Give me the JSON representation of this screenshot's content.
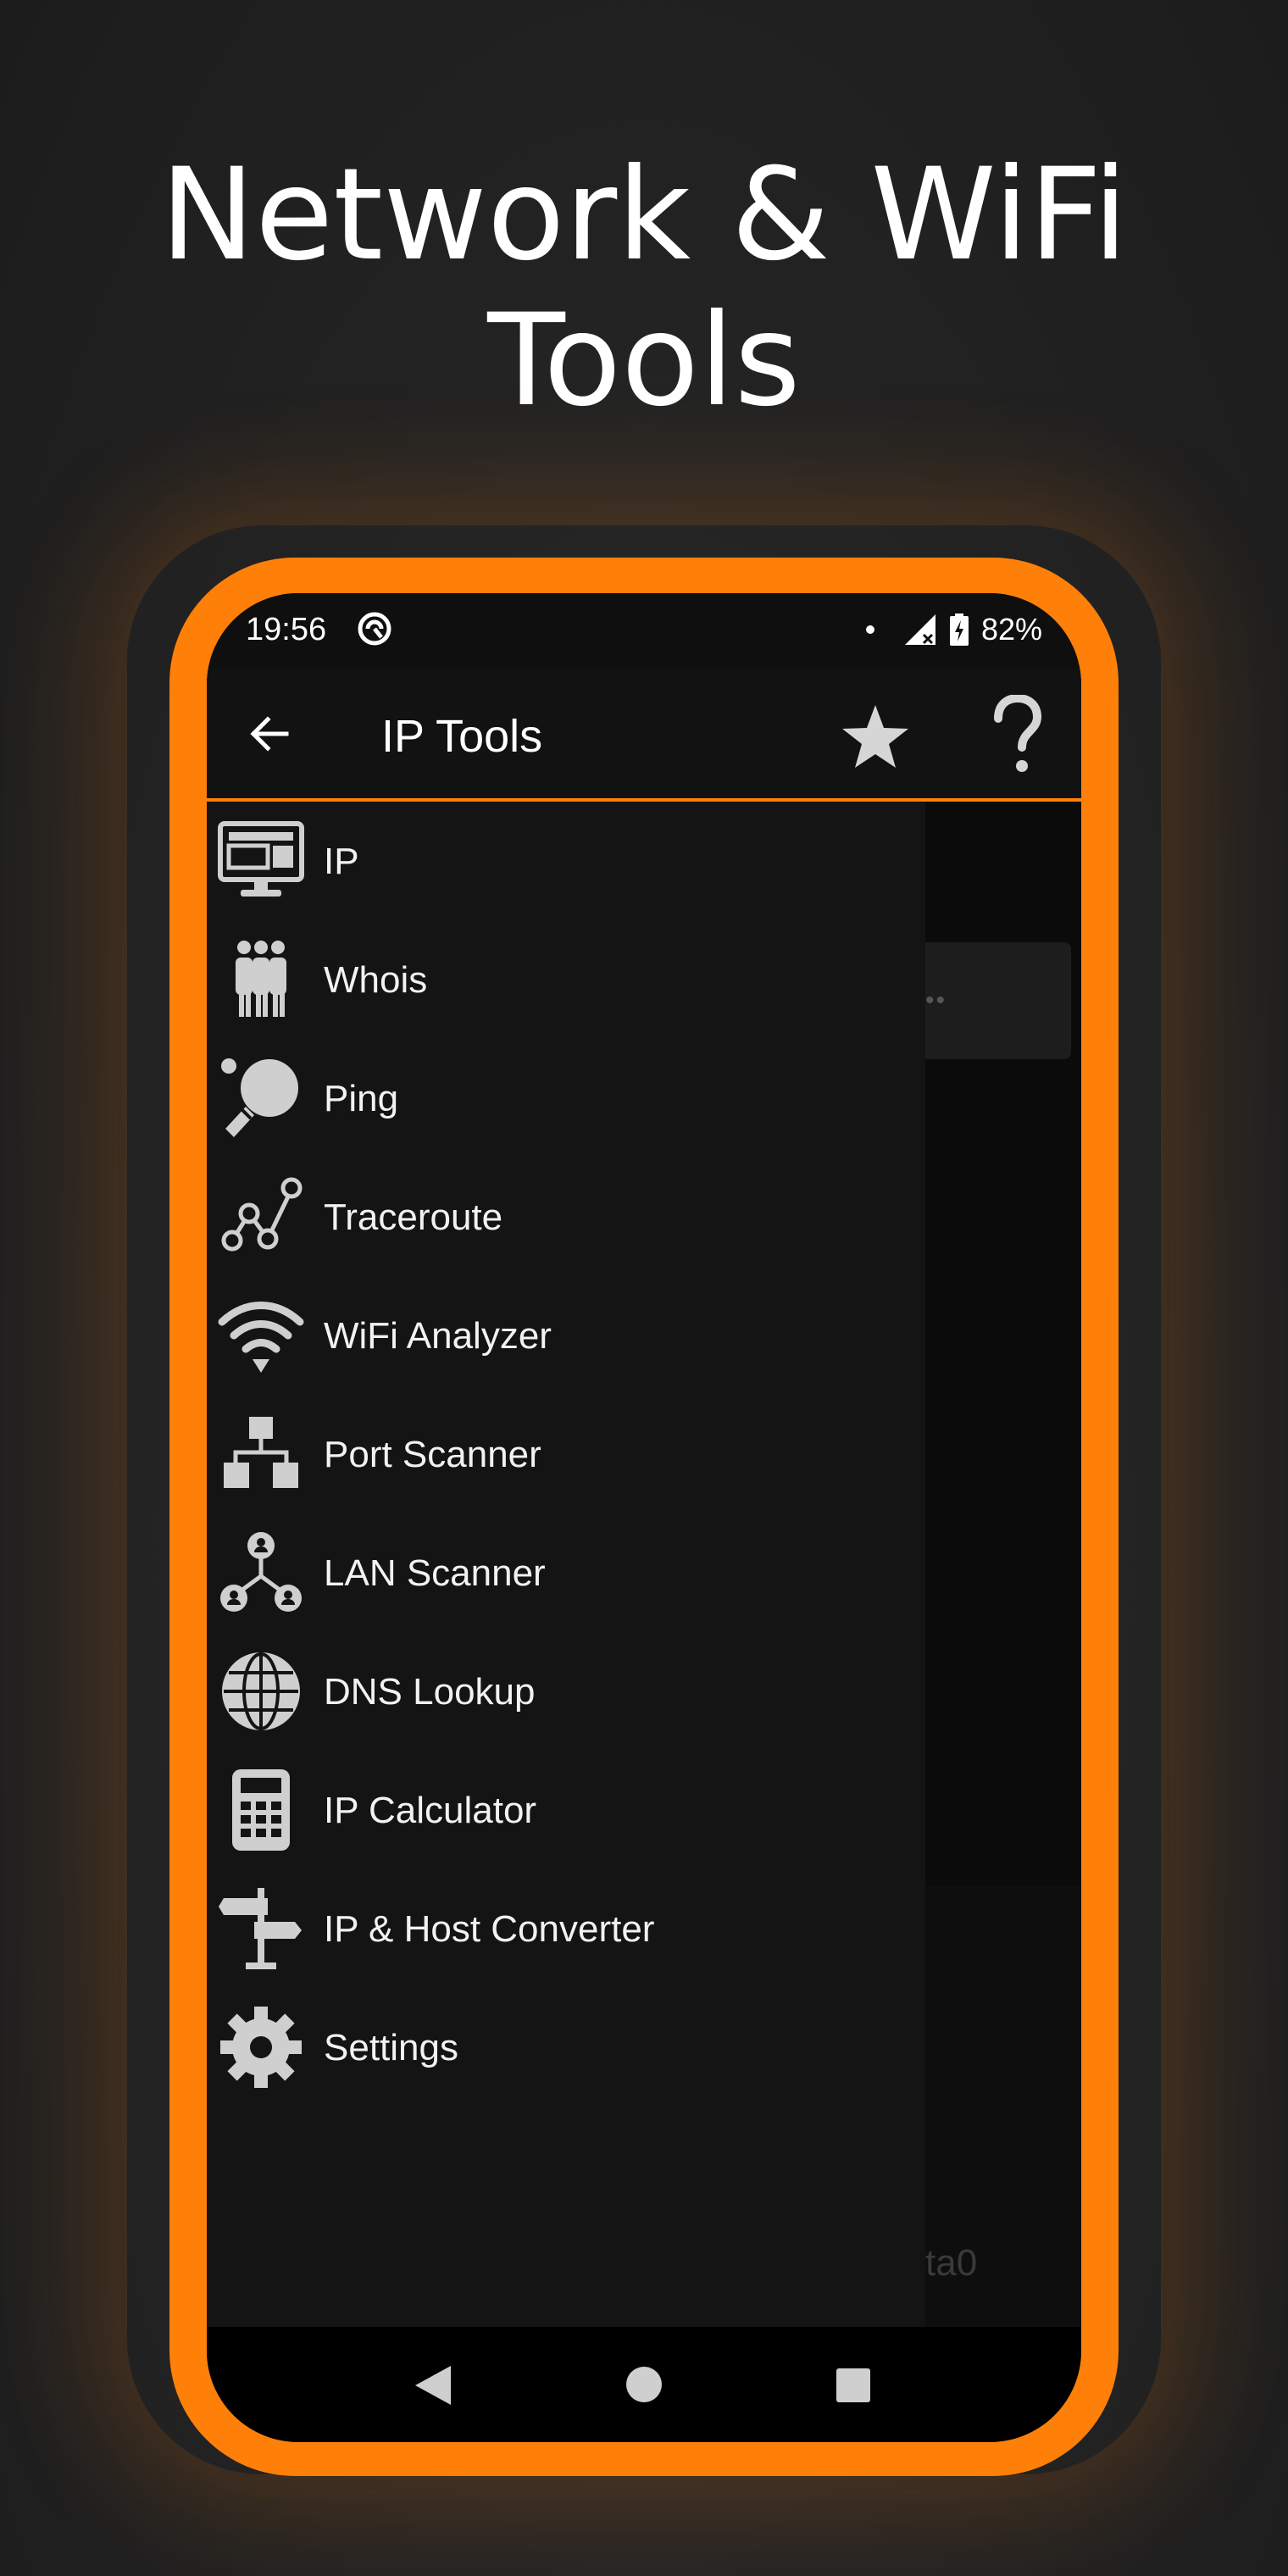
{
  "headline": {
    "line1": "Network & WiFi",
    "line2": "Tools"
  },
  "colors": {
    "accent": "#ff8008",
    "background": "#232323",
    "drawer": "#141414",
    "icon": "#cfcfcf"
  },
  "status_bar": {
    "time": "19:56",
    "battery": "82%",
    "icons": [
      "app-notification-icon",
      "signal-icon",
      "battery-charging-icon"
    ]
  },
  "app_bar": {
    "title": "IP Tools",
    "back_icon": "arrow-back-icon",
    "actions": [
      "star-icon",
      "help-icon"
    ]
  },
  "drawer": {
    "items": [
      {
        "label": "IP",
        "icon": "monitor-icon"
      },
      {
        "label": "Whois",
        "icon": "people-icon"
      },
      {
        "label": "Ping",
        "icon": "ping-pong-icon"
      },
      {
        "label": "Traceroute",
        "icon": "route-icon"
      },
      {
        "label": "WiFi Analyzer",
        "icon": "wifi-icon"
      },
      {
        "label": "Port Scanner",
        "icon": "network-hierarchy-icon"
      },
      {
        "label": "LAN Scanner",
        "icon": "lan-users-icon"
      },
      {
        "label": "DNS Lookup",
        "icon": "globe-icon"
      },
      {
        "label": "IP Calculator",
        "icon": "calculator-icon"
      },
      {
        "label": "IP & Host Converter",
        "icon": "signpost-icon"
      },
      {
        "label": "Settings",
        "icon": "gear-icon"
      }
    ]
  },
  "background": {
    "dots": "••",
    "text1": "ta0",
    "text2": "0"
  },
  "nav_bar": {
    "icons": [
      "nav-back-icon",
      "nav-home-icon",
      "nav-recent-icon"
    ]
  }
}
